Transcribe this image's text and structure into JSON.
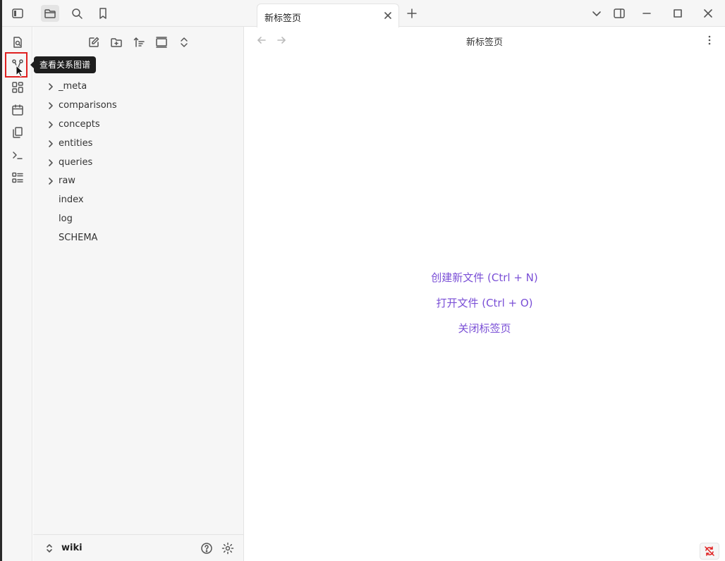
{
  "ribbon": {
    "tooltip": "查看关系图谱",
    "icons": [
      "quick-switcher-icon",
      "graph-view-icon",
      "canvas-icon",
      "daily-notes-icon",
      "templates-icon",
      "command-palette-icon",
      "bases-icon"
    ]
  },
  "sidebar_tabs": [
    "files-icon",
    "search-icon",
    "bookmarks-icon"
  ],
  "explorer": {
    "toolbar": [
      "new-note-icon",
      "new-folder-icon",
      "sort-icon",
      "collapse-icon",
      "expand-collapse-icon"
    ],
    "folders": [
      "_meta",
      "comparisons",
      "concepts",
      "entities",
      "queries",
      "raw"
    ],
    "files": [
      "index",
      "log",
      "SCHEMA"
    ]
  },
  "vault": {
    "name": "wiki"
  },
  "tab": {
    "title": "新标签页"
  },
  "view": {
    "title": "新标签页"
  },
  "empty_state": {
    "create_file": "创建新文件 (Ctrl + N)",
    "open_file": "打开文件 (Ctrl + O)",
    "close_tab": "关闭标签页"
  },
  "colors": {
    "accent": "#7a4fd6",
    "highlight_box": "#e02020"
  }
}
